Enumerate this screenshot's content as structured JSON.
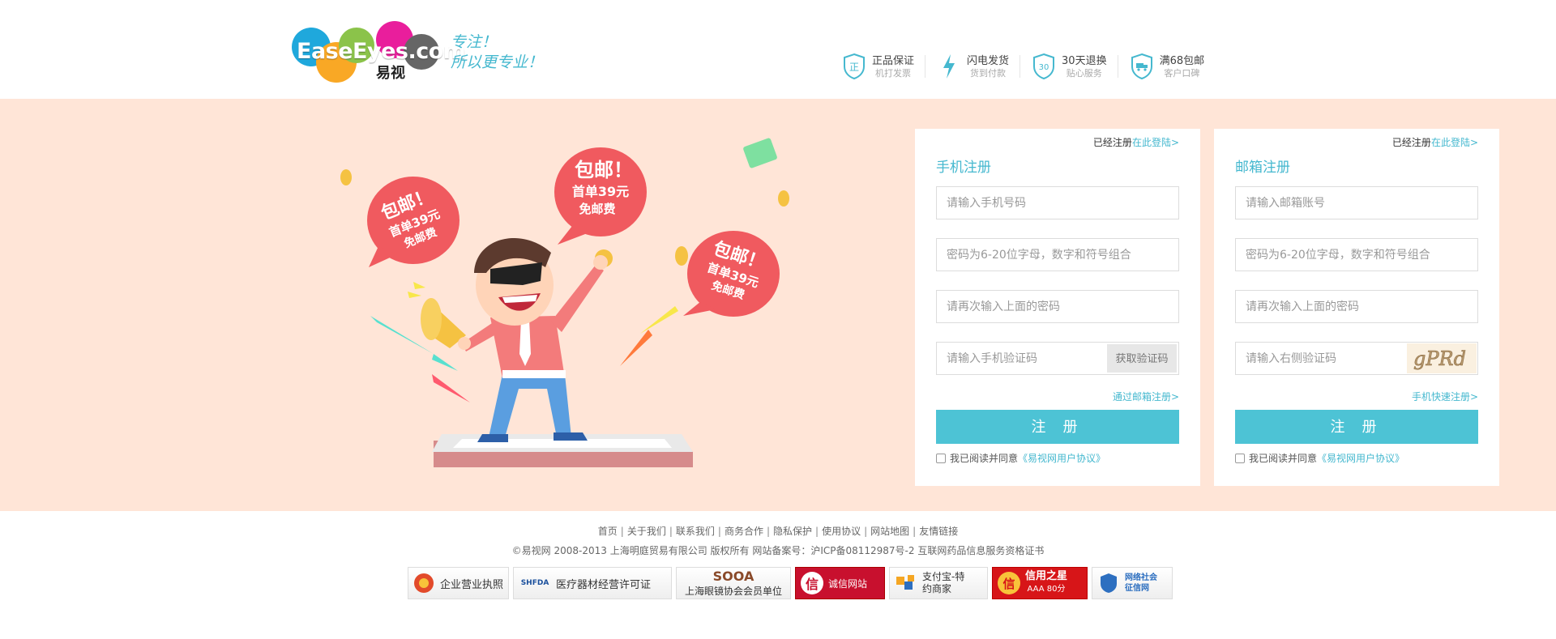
{
  "header": {
    "logo_text": "EaseEyes.com",
    "logo_cn": "易视",
    "slogan_line1": "专注！",
    "slogan_line2": "所以更专业！",
    "guarantees": [
      {
        "title": "正品保证",
        "sub": "机打发票",
        "icon": "shield-zheng-icon",
        "glyph": "正"
      },
      {
        "title": "闪电发货",
        "sub": "货到付款",
        "icon": "lightning-icon"
      },
      {
        "title": "30天退换",
        "sub": "贴心服务",
        "icon": "shield-30-icon",
        "glyph": "30"
      },
      {
        "title": "满68包邮",
        "sub": "客户口碑",
        "icon": "shield-truck-icon"
      }
    ]
  },
  "banner": {
    "promo_bubbles": [
      {
        "line1": "包邮！",
        "line2": "首单39元",
        "line3": "免邮费"
      },
      {
        "line1": "包邮！",
        "line2": "首单39元",
        "line3": "免邮费"
      },
      {
        "line1": "包邮！",
        "line2": "首单39元",
        "line3": "免邮费"
      }
    ]
  },
  "phone_panel": {
    "login_hint": "已经注册",
    "login_link": "在此登陆>",
    "title": "手机注册",
    "phone_placeholder": "请输入手机号码",
    "password_placeholder": "密码为6-20位字母，数字和符号组合",
    "confirm_placeholder": "请再次输入上面的密码",
    "code_placeholder": "请输入手机验证码",
    "get_code_label": "获取验证码",
    "alt_link": "通过邮箱注册>",
    "register_label": "注 册",
    "agree_text": "我已阅读并同意",
    "agree_link": "《易视网用户协议》"
  },
  "email_panel": {
    "login_hint": "已经注册",
    "login_link": "在此登陆>",
    "title": "邮箱注册",
    "email_placeholder": "请输入邮箱账号",
    "password_placeholder": "密码为6-20位字母，数字和符号组合",
    "confirm_placeholder": "请再次输入上面的密码",
    "captcha_placeholder": "请输入右侧验证码",
    "captcha_text": "gPRd",
    "alt_link": "手机快速注册>",
    "register_label": "注 册",
    "agree_text": "我已阅读并同意",
    "agree_link": "《易视网用户协议》"
  },
  "footer": {
    "links": [
      "首页",
      "关于我们",
      "联系我们",
      "商务合作",
      "隐私保护",
      "使用协议",
      "网站地图",
      "友情链接"
    ],
    "copyright": "©易视网 2008-2013 上海明庭贸易有限公司 版权所有 网站备案号：沪ICP备08112987号-2 互联网药品信息服务资格证书",
    "badges": [
      {
        "label": "企业营业执照",
        "icon": "business-license-icon"
      },
      {
        "label": "医疗器材经营许可证",
        "icon": "shfda-icon",
        "mark": "SHFDA"
      },
      {
        "label": "上海眼镜协会会员单位",
        "icon": "sooa-icon",
        "mark": "SOOA"
      },
      {
        "label": "诚信网站",
        "icon": "credit-site-icon",
        "mark": "信"
      },
      {
        "label": "支付宝-特约商家",
        "icon": "alipay-icon"
      },
      {
        "label": "信用之星",
        "sub": "AAA 80分",
        "icon": "credit-star-icon",
        "mark": "信"
      },
      {
        "label": "网络社会征信网",
        "icon": "credit-network-icon"
      }
    ]
  },
  "colors": {
    "accent": "#4dc3d5",
    "banner_bg": "#ffe5d7",
    "promo_red": "#f05a5f"
  }
}
